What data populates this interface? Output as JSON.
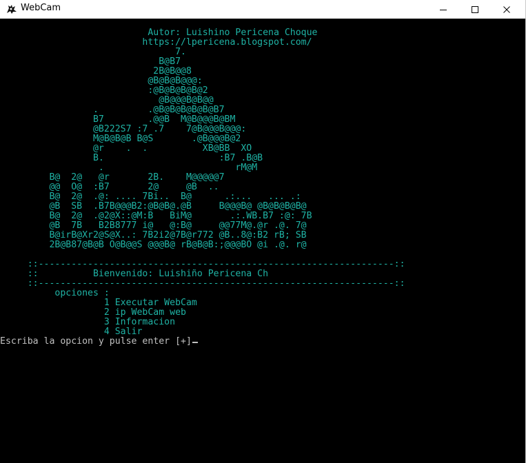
{
  "window": {
    "title": "WebCam",
    "icon": "webcam-app-icon",
    "controls": [
      "minimize-icon",
      "maximize-icon",
      "close-icon"
    ]
  },
  "console": {
    "colors": {
      "background": "#000000",
      "banner": "#1fb3a5",
      "prompt": "#c0c0c0"
    },
    "lines": [
      "                           Autor: Luishino Pericena Choque",
      "                          https://lpericena.blogspot.com/",
      "                                7.",
      "                             B@B7",
      "                            2B@B@@8",
      "                           @B@B@B@@@:",
      "                           :@B@B@B@B@2",
      "                             @B@@@B@B@@",
      "                 .         .@B@B@B@B@B@B7",
      "                 B7        .@@B  M@B@@@B@BM",
      "                 @B222S7 :7 .7    7@B@@@B@@@:",
      "                 M@B@B@B B@S       .@B@@@B@2",
      "                 @r    .  .          XB@BB  XO",
      "                 B.                     :B7 .B@B",
      "                  .                        rM@M",
      "         B@  2@   @r       2B.    M@@@@@7",
      "         @@  O@  :B7       2@     @B  ..",
      "         B@  2@  .@: .... 7Bi..  B@      .:...   ... .:",
      "         @B  SB  .B7B@@@B2:@B@B@.@B     B@@@B@ @B@B@B@B@",
      "         B@  2@  .@2@X::@M:B   BiM@       .:.WB.B7 :@: 7B",
      "         @B  7B   B2B8777 i@   @:B@     @@77M@.@r .@. 7@",
      "         B@irB@Xr2@S@X..: 7B2i2@7B@r772 @B..8@:B2 rB; SB",
      "         2B@B87@B@B O@B@@S @@@B@ rB@B@B:;@@@BO @i .@. r@"
    ],
    "menu": {
      "border_top": "     ::-----------------------------------------------------------------::",
      "welcome": "     ::          Bienvenido: Luishiño Pericena Ch",
      "border_bottom": "     ::-----------------------------------------------------------------::",
      "heading": "          opciones :",
      "options": [
        "                   1 Executar WebCam",
        "                   2 ip WebCam web",
        "                   3 Informacion",
        "                   4 Salir"
      ]
    },
    "prompt": "Escriba la opcion y pulse enter [+]"
  }
}
